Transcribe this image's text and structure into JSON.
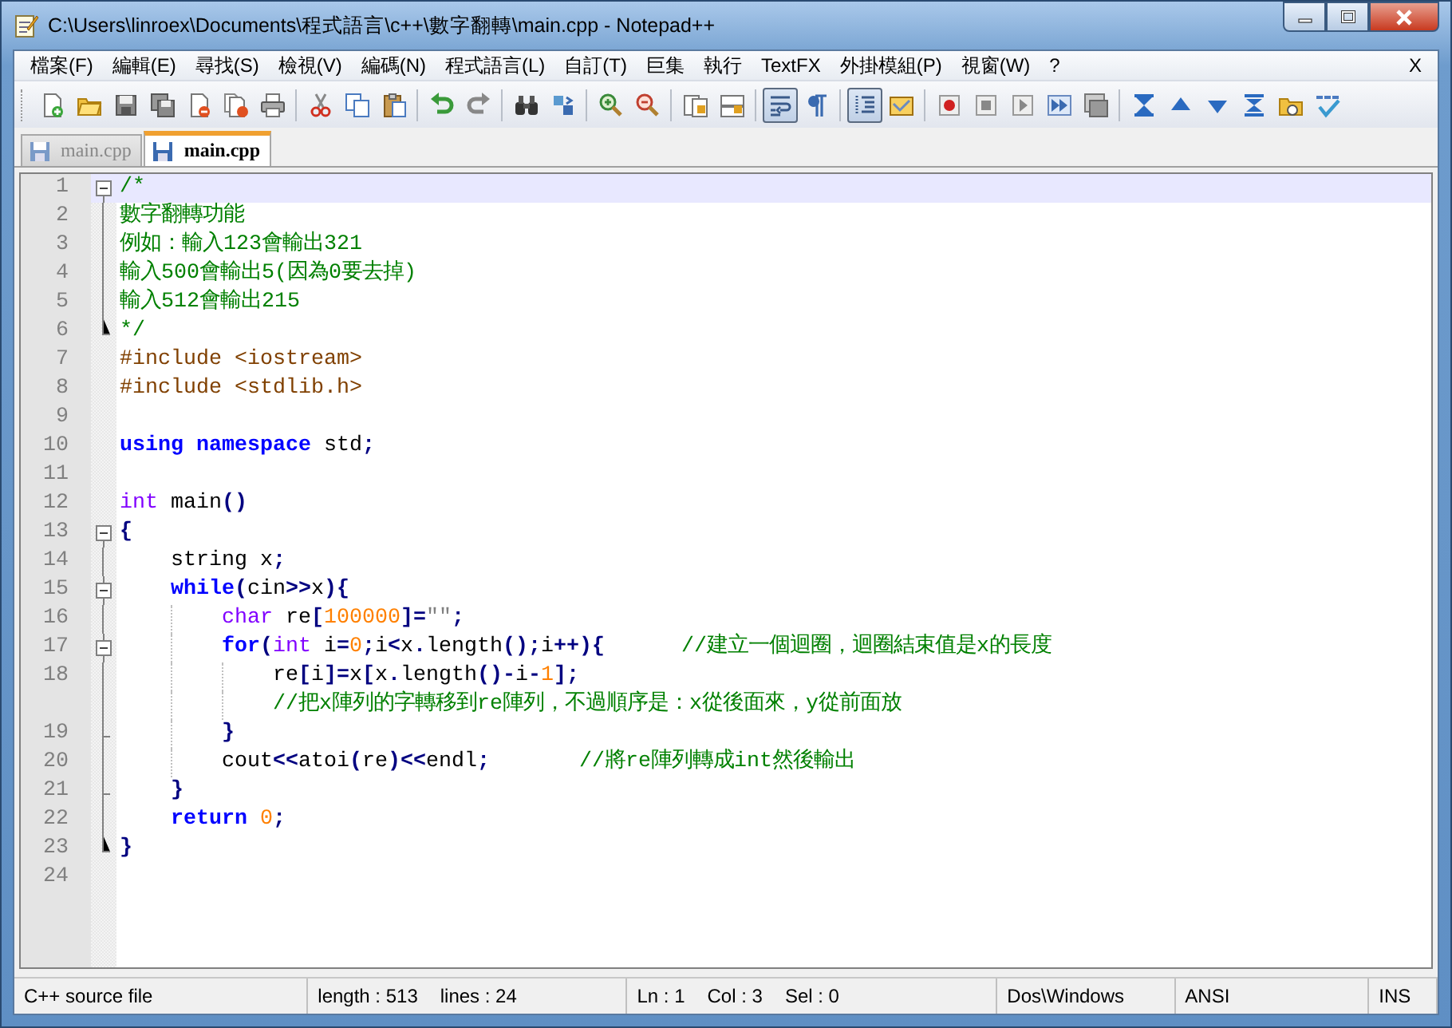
{
  "window": {
    "title": "C:\\Users\\linroex\\Documents\\程式語言\\c++\\數字翻轉\\main.cpp - Notepad++"
  },
  "menu": [
    "檔案(F)",
    "編輯(E)",
    "尋找(S)",
    "檢視(V)",
    "編碼(N)",
    "程式語言(L)",
    "自訂(T)",
    "巨集",
    "執行",
    "TextFX",
    "外掛模組(P)",
    "視窗(W)",
    "?"
  ],
  "menu_close": "X",
  "toolbar": [
    [
      {
        "pressed": false
      },
      {
        "pressed": false
      },
      {
        "pressed": false
      },
      {
        "pressed": false
      },
      {
        "pressed": false
      },
      {
        "pressed": false
      },
      {
        "pressed": false
      }
    ],
    [
      {
        "pressed": false
      },
      {
        "pressed": false
      },
      {
        "pressed": false
      }
    ],
    [
      {
        "pressed": false
      },
      {
        "pressed": false
      }
    ],
    [
      {
        "pressed": false
      },
      {
        "pressed": false
      }
    ],
    [
      {
        "pressed": false
      },
      {
        "pressed": false
      }
    ],
    [
      {
        "pressed": false
      },
      {
        "pressed": false
      }
    ],
    [
      {
        "pressed": true
      },
      {
        "pressed": false
      }
    ],
    [
      {
        "pressed": true
      },
      {
        "pressed": false
      }
    ],
    [
      {
        "pressed": false
      },
      {
        "pressed": false
      },
      {
        "pressed": false
      },
      {
        "pressed": false
      },
      {
        "pressed": false
      }
    ],
    [
      {
        "pressed": false
      },
      {
        "pressed": false
      },
      {
        "pressed": false
      },
      {
        "pressed": false
      },
      {
        "pressed": false
      },
      {
        "pressed": false
      }
    ]
  ],
  "tabs": [
    {
      "label": "main.cpp",
      "selected": false
    },
    {
      "label": "main.cpp",
      "selected": true
    }
  ],
  "editor": {
    "lines": [
      {
        "number": "1",
        "kind": "fold_open",
        "current": true,
        "tokens": [
          {
            "kind": "comment",
            "text": "/*"
          }
        ]
      },
      {
        "number": "2",
        "kind": "fold_line",
        "current": false,
        "tokens": [
          {
            "kind": "comment",
            "text": "數字翻轉功能"
          }
        ]
      },
      {
        "number": "3",
        "kind": "fold_line",
        "current": false,
        "tokens": [
          {
            "kind": "comment",
            "text": "例如：輸入123會輸出321"
          }
        ]
      },
      {
        "number": "4",
        "kind": "fold_line",
        "current": false,
        "tokens": [
          {
            "kind": "comment",
            "text": "輸入500會輸出5(因為0要去掉)"
          }
        ]
      },
      {
        "number": "5",
        "kind": "fold_line",
        "current": false,
        "tokens": [
          {
            "kind": "comment",
            "text": "輸入512會輸出215"
          }
        ]
      },
      {
        "number": "6",
        "kind": "fold_end",
        "current": false,
        "tokens": [
          {
            "kind": "comment",
            "text": "*/"
          }
        ]
      },
      {
        "number": "7",
        "kind": "plain",
        "current": false,
        "tokens": [
          {
            "kind": "preproc",
            "text": "#include <iostream>"
          }
        ]
      },
      {
        "number": "8",
        "kind": "plain",
        "current": false,
        "tokens": [
          {
            "kind": "preproc",
            "text": "#include <stdlib.h>"
          }
        ]
      },
      {
        "number": "9",
        "kind": "plain",
        "current": false
      },
      {
        "number": "10",
        "kind": "plain",
        "current": false,
        "tokens": [
          {
            "kind": "keyword",
            "text": "using "
          },
          {
            "kind": "keyword",
            "text": "namespace"
          },
          {
            "kind": "plain",
            "text": " std"
          },
          {
            "kind": "operator",
            "text": ";"
          }
        ]
      },
      {
        "number": "11",
        "kind": "plain",
        "current": false
      },
      {
        "number": "12",
        "kind": "plain",
        "current": false,
        "tokens": [
          {
            "kind": "type",
            "text": "int"
          },
          {
            "kind": "plain",
            "text": " main"
          },
          {
            "kind": "operator",
            "text": "()"
          }
        ]
      },
      {
        "number": "13",
        "kind": "fold_open",
        "current": false,
        "tokens": [
          {
            "kind": "operator",
            "text": "{"
          }
        ]
      },
      {
        "number": "14",
        "kind": "fold_line",
        "current": false,
        "tokens": [
          {
            "kind": "plain",
            "text": "    string x"
          },
          {
            "kind": "operator",
            "text": ";"
          }
        ]
      },
      {
        "number": "15",
        "kind": "fold_open_nested",
        "current": false,
        "tokens": [
          {
            "kind": "keyword",
            "text": "    while"
          },
          {
            "kind": "operator",
            "text": "("
          },
          {
            "kind": "plain",
            "text": "cin"
          },
          {
            "kind": "operator",
            "text": ">>"
          },
          {
            "kind": "plain",
            "text": "x"
          },
          {
            "kind": "operator",
            "text": "){"
          }
        ]
      },
      {
        "number": "16",
        "kind": "fold_line",
        "current": false,
        "tokens": [
          {
            "kind": "type",
            "text": "        char"
          },
          {
            "kind": "plain",
            "text": " re"
          },
          {
            "kind": "operator",
            "text": "["
          },
          {
            "kind": "number",
            "text": "100000"
          },
          {
            "kind": "operator",
            "text": "]="
          },
          {
            "kind": "string",
            "text": "\"\""
          },
          {
            "kind": "operator",
            "text": ";"
          }
        ]
      },
      {
        "number": "17",
        "kind": "fold_open_nested",
        "current": false,
        "tokens": [
          {
            "kind": "keyword",
            "text": "        for"
          },
          {
            "kind": "operator",
            "text": "("
          },
          {
            "kind": "type",
            "text": "int"
          },
          {
            "kind": "plain",
            "text": " i"
          },
          {
            "kind": "operator",
            "text": "="
          },
          {
            "kind": "number",
            "text": "0"
          },
          {
            "kind": "operator",
            "text": ";"
          },
          {
            "kind": "plain",
            "text": "i"
          },
          {
            "kind": "operator",
            "text": "<"
          },
          {
            "kind": "plain",
            "text": "x"
          },
          {
            "kind": "operator",
            "text": "."
          },
          {
            "kind": "plain",
            "text": "length"
          },
          {
            "kind": "operator",
            "text": "();"
          },
          {
            "kind": "plain",
            "text": "i"
          },
          {
            "kind": "operator",
            "text": "++){"
          },
          {
            "kind": "comment",
            "text": "      //建立一個迴圈，迴圈結束值是x的長度"
          }
        ]
      },
      {
        "number": "18",
        "kind": "fold_line",
        "current": false,
        "tokens": [
          {
            "kind": "plain",
            "text": "            re"
          },
          {
            "kind": "operator",
            "text": "["
          },
          {
            "kind": "plain",
            "text": "i"
          },
          {
            "kind": "operator",
            "text": "]="
          },
          {
            "kind": "plain",
            "text": "x"
          },
          {
            "kind": "operator",
            "text": "["
          },
          {
            "kind": "plain",
            "text": "x"
          },
          {
            "kind": "operator",
            "text": "."
          },
          {
            "kind": "plain",
            "text": "length"
          },
          {
            "kind": "operator",
            "text": "()-"
          },
          {
            "kind": "plain",
            "text": "i"
          },
          {
            "kind": "operator",
            "text": "-"
          },
          {
            "kind": "number",
            "text": "1"
          },
          {
            "kind": "operator",
            "text": "];"
          }
        ],
        "wrap": [
          {
            "kind": "comment",
            "text": "//把x陣列的字轉移到re陣列，不過順序是：x從後面來，y從前面放"
          }
        ]
      },
      {
        "number": "19",
        "kind": "fold_end_nested",
        "current": false,
        "tokens": [
          {
            "kind": "operator",
            "text": "        }"
          }
        ]
      },
      {
        "number": "20",
        "kind": "fold_line",
        "current": false,
        "tokens": [
          {
            "kind": "plain",
            "text": "        cout"
          },
          {
            "kind": "operator",
            "text": "<<"
          },
          {
            "kind": "plain",
            "text": "atoi"
          },
          {
            "kind": "operator",
            "text": "("
          },
          {
            "kind": "plain",
            "text": "re"
          },
          {
            "kind": "operator",
            "text": ")<<"
          },
          {
            "kind": "plain",
            "text": "endl"
          },
          {
            "kind": "operator",
            "text": ";"
          },
          {
            "kind": "comment",
            "text": "       //將re陣列轉成int然後輸出"
          }
        ]
      },
      {
        "number": "21",
        "kind": "fold_end_nested",
        "current": false,
        "tokens": [
          {
            "kind": "operator",
            "text": "    }"
          }
        ]
      },
      {
        "number": "22",
        "kind": "fold_line",
        "current": false,
        "tokens": [
          {
            "kind": "keyword",
            "text": "    return "
          },
          {
            "kind": "number",
            "text": "0"
          },
          {
            "kind": "operator",
            "text": ";"
          }
        ]
      },
      {
        "number": "23",
        "kind": "fold_end",
        "current": false,
        "tokens": [
          {
            "kind": "operator",
            "text": "}"
          }
        ]
      },
      {
        "number": "24",
        "kind": "plain",
        "current": false
      }
    ]
  },
  "status_bar": [
    [
      "C++ source file"
    ],
    [
      "length : 513",
      "lines : 24"
    ],
    [
      "Ln : 1",
      "Col : 3",
      "Sel : 0"
    ],
    [
      "Dos\\Windows"
    ],
    [
      "ANSI"
    ],
    [
      "INS"
    ]
  ]
}
